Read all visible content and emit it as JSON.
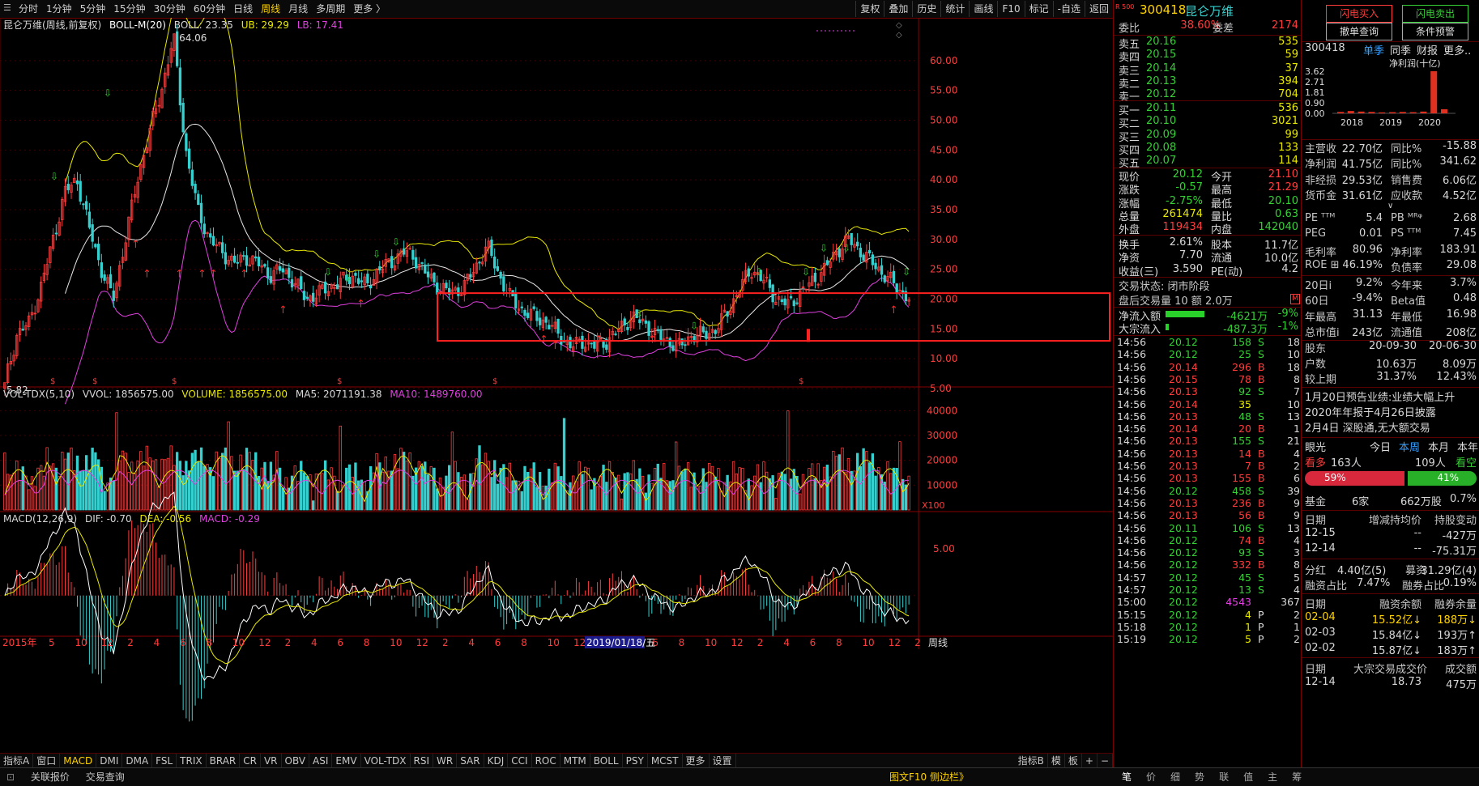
{
  "toolbar": {
    "left": [
      "分时",
      "1分钟",
      "5分钟",
      "15分钟",
      "30分钟",
      "60分钟",
      "日线",
      "周线",
      "月线",
      "多周期",
      "更多 〉"
    ],
    "active": "周线",
    "right": [
      "复权",
      "叠加",
      "历史",
      "统计",
      "画线",
      "F10",
      "标记",
      "-自选",
      "返回"
    ]
  },
  "main_legend": {
    "title": "昆仑万维(周线,前复权)",
    "boll": "BOLL-M(20)",
    "boll_val": "BOLL: 23.35",
    "ub": "UB: 29.29",
    "lb": "LB: 17.41"
  },
  "vol_legend": {
    "name": "VOL-TDX(5,10)",
    "vvol": "VVOL: 1856575.00",
    "volume": "VOLUME: 1856575.00",
    "ma5": "MA5: 2071191.38",
    "ma10": "MA10: 1489760.00"
  },
  "macd_legend": {
    "name": "MACD(12,26,9)",
    "dif": "DIF: -0.70",
    "dea": "DEA: -0.56",
    "macd": "MACD: -0.29"
  },
  "price_axis": [
    "60.00",
    "55.00",
    "50.00",
    "45.00",
    "40.00",
    "35.00",
    "30.00",
    "25.00",
    "20.00",
    "15.00",
    "10.00",
    "5.00"
  ],
  "vol_axis": [
    "40000",
    "30000",
    "20000",
    "10000"
  ],
  "vol_unit": "X100",
  "macd_axis": [
    "5.00"
  ],
  "high_label": "64.06",
  "low_label": "5.82",
  "time_axis": {
    "year": "2015年",
    "labels": [
      "5",
      "10",
      "12",
      "2",
      "4",
      "6",
      "8",
      "10",
      "12",
      "2",
      "4",
      "6",
      "8",
      "10",
      "12",
      "2",
      "4",
      "6",
      "8",
      "10",
      "12",
      "2",
      "4",
      "6",
      "8",
      "10",
      "12",
      "2",
      "4",
      "6",
      "8",
      "10",
      "12",
      "2"
    ],
    "cursor": "2019/01/18/五",
    "unit": "周线"
  },
  "indicator_tabs": [
    "指标A",
    "窗口",
    "MACD",
    "DMI",
    "DMA",
    "FSL",
    "TRIX",
    "BRAR",
    "CR",
    "VR",
    "OBV",
    "ASI",
    "EMV",
    "VOL-TDX",
    "RSI",
    "WR",
    "SAR",
    "KDJ",
    "CCI",
    "ROC",
    "MTM",
    "BOLL",
    "PSY",
    "MCST",
    "更多",
    "设置"
  ],
  "indicator_active": "MACD",
  "indicator_right": [
    "指标B",
    "模",
    "板",
    "+",
    "−"
  ],
  "status_left": [
    "关联报价",
    "交易查询"
  ],
  "status_right": "图文F10 侧边栏》",
  "status_tabs": [
    "笔",
    "价",
    "细",
    "势",
    "联",
    "值",
    "主",
    "筹"
  ],
  "stock": {
    "code": "300418",
    "name": "昆仑万维",
    "badge": "R 500"
  },
  "weibi": {
    "label1": "委比",
    "v1": "38.60%",
    "label2": "委差",
    "v2": "2174"
  },
  "asks": [
    {
      "l": "卖五",
      "p": "20.16",
      "v": "535"
    },
    {
      "l": "卖四",
      "p": "20.15",
      "v": "59"
    },
    {
      "l": "卖三",
      "p": "20.14",
      "v": "37"
    },
    {
      "l": "卖二",
      "p": "20.13",
      "v": "394"
    },
    {
      "l": "卖一",
      "p": "20.12",
      "v": "704"
    }
  ],
  "bids": [
    {
      "l": "买一",
      "p": "20.11",
      "v": "536"
    },
    {
      "l": "买二",
      "p": "20.10",
      "v": "3021"
    },
    {
      "l": "买三",
      "p": "20.09",
      "v": "99"
    },
    {
      "l": "买四",
      "p": "20.08",
      "v": "133"
    },
    {
      "l": "买五",
      "p": "20.07",
      "v": "114"
    }
  ],
  "stats": [
    {
      "l": "现价",
      "v": "20.12",
      "c": "dn",
      "l2": "今开",
      "v2": "21.10",
      "c2": "up"
    },
    {
      "l": "涨跌",
      "v": "-0.57",
      "c": "dn",
      "l2": "最高",
      "v2": "21.29",
      "c2": "up"
    },
    {
      "l": "涨幅",
      "v": "-2.75%",
      "c": "dn",
      "l2": "最低",
      "v2": "20.10",
      "c2": "dn"
    },
    {
      "l": "总量",
      "v": "261474",
      "c": "yl",
      "l2": "量比",
      "v2": "0.63",
      "c2": "dn"
    },
    {
      "l": "外盘",
      "v": "119434",
      "c": "up",
      "l2": "内盘",
      "v2": "142040",
      "c2": "dn"
    }
  ],
  "stats2": [
    {
      "l": "换手",
      "v": "2.61%",
      "l2": "股本",
      "v2": "11.7亿"
    },
    {
      "l": "净资",
      "v": "7.70",
      "l2": "流通",
      "v2": "10.0亿"
    },
    {
      "l": "收益(三)",
      "v": "3.590",
      "l2": "PE(动)",
      "v2": "4.2"
    }
  ],
  "trade_state": "交易状态: 闭市阶段",
  "after_hours": "盘后交易量 10 额 2.0万",
  "flow": [
    {
      "l": "净流入额",
      "v": "-4621万",
      "p": "-9%"
    },
    {
      "l": "大宗流入",
      "v": "-487.3万",
      "p": "-1%"
    }
  ],
  "ticks": [
    [
      "14:56",
      "20.12",
      "158",
      "S",
      "18"
    ],
    [
      "14:56",
      "20.12",
      "25",
      "S",
      "10"
    ],
    [
      "14:56",
      "20.14",
      "296",
      "B",
      "18"
    ],
    [
      "14:56",
      "20.15",
      "78",
      "B",
      "8"
    ],
    [
      "14:56",
      "20.13",
      "92",
      "S",
      "7"
    ],
    [
      "14:56",
      "20.14",
      "35",
      "",
      "10"
    ],
    [
      "14:56",
      "20.13",
      "48",
      "S",
      "13"
    ],
    [
      "14:56",
      "20.14",
      "20",
      "B",
      "1"
    ],
    [
      "14:56",
      "20.13",
      "155",
      "S",
      "21"
    ],
    [
      "14:56",
      "20.13",
      "14",
      "B",
      "4"
    ],
    [
      "14:56",
      "20.13",
      "7",
      "B",
      "2"
    ],
    [
      "14:56",
      "20.13",
      "155",
      "B",
      "6"
    ],
    [
      "14:56",
      "20.12",
      "458",
      "S",
      "39"
    ],
    [
      "14:56",
      "20.13",
      "236",
      "B",
      "9"
    ],
    [
      "14:56",
      "20.13",
      "56",
      "B",
      "9"
    ],
    [
      "14:56",
      "20.11",
      "106",
      "S",
      "13"
    ],
    [
      "14:56",
      "20.12",
      "74",
      "B",
      "4"
    ],
    [
      "14:56",
      "20.12",
      "93",
      "S",
      "3"
    ],
    [
      "14:56",
      "20.12",
      "332",
      "B",
      "8"
    ],
    [
      "14:57",
      "20.12",
      "45",
      "S",
      "5"
    ],
    [
      "14:57",
      "20.12",
      "13",
      "S",
      "4"
    ],
    [
      "15:00",
      "20.12",
      "4543",
      "",
      "367"
    ],
    [
      "15:15",
      "20.12",
      "4",
      "P",
      "2"
    ],
    [
      "15:18",
      "20.12",
      "1",
      "P",
      "1"
    ],
    [
      "15:19",
      "20.12",
      "5",
      "P",
      "2"
    ]
  ],
  "buttons": {
    "flash_buy": "闪电买入",
    "flash_sell": "闪电卖出",
    "cancel": "撤单查询",
    "cond": "条件预警"
  },
  "f10": {
    "code": "300418",
    "tabs": [
      "单季",
      "同季",
      "财报",
      "更多.."
    ],
    "bar_axis": [
      "3.62",
      "2.71",
      "1.81",
      "0.90",
      "0.00"
    ],
    "bar_title": "净利润(十亿)",
    "bar_years": [
      "2018",
      "2019",
      "2020"
    ],
    "bar_values": [
      0.12,
      0.2,
      0.15,
      0.12,
      0.08,
      0.1,
      0.12,
      0.1,
      0.15,
      3.62,
      0.35
    ],
    "fin": [
      [
        "主营收",
        "22.70亿",
        "同比%",
        "-15.88"
      ],
      [
        "净利润",
        "41.75亿",
        "同比%",
        "341.62"
      ],
      [
        "非经损",
        "29.53亿",
        "销售费",
        "6.06亿"
      ],
      [
        "货币金",
        "31.61亿",
        "应收款",
        "4.52亿"
      ]
    ],
    "val": [
      [
        "PE ᵀᵀᴹ",
        "5.4",
        "PB ᴹᴿᵠ",
        "2.68"
      ],
      [
        "PEG",
        "0.01",
        "PS ᵀᵀᴹ",
        "7.45"
      ],
      [
        "毛利率",
        "80.96",
        "净利率",
        "183.91"
      ],
      [
        "ROE ⊞",
        "46.19%",
        "负债率",
        "29.08"
      ]
    ],
    "perf": [
      [
        "20日i",
        "9.2%",
        "今年来",
        "3.7%"
      ],
      [
        "60日",
        "-9.4%",
        "Beta值",
        "0.48"
      ],
      [
        "年最高",
        "31.13",
        "年最低",
        "16.98"
      ],
      [
        "总市值i",
        "243亿",
        "流通值",
        "208亿"
      ]
    ],
    "holders": [
      [
        "股东",
        "20-09-30",
        "20-06-30"
      ],
      [
        "户数",
        "10.63万",
        "8.09万"
      ],
      [
        "较上期",
        "31.37%",
        "12.43%"
      ]
    ],
    "news": [
      "1月20日预告业绩:业绩大幅上升",
      "2020年年报于4月26日披露",
      "2月4日 深股通,无大额交易"
    ],
    "eye": {
      "label": "眼光",
      "tabs": [
        "今日",
        "本周",
        "本月",
        "本年"
      ],
      "bull_label": "看多",
      "bull": "163人",
      "bear": "109人",
      "bear_label": "看空",
      "bull_pct": "59%",
      "bear_pct": "41%"
    },
    "fund": [
      "基金",
      "6家",
      "662万股",
      "0.7%"
    ],
    "hold_head": [
      "日期",
      "增减持均价",
      "持股变动"
    ],
    "hold": [
      [
        "12-15",
        "--",
        "-427万"
      ],
      [
        "12-14",
        "--",
        "-75.31万"
      ]
    ],
    "div": [
      "分红",
      "4.40亿(5)",
      "募资",
      "31.29亿(4)"
    ],
    "margin_ratio": [
      "融资占比",
      "7.47%",
      "融券占比",
      "0.19%"
    ],
    "margin_head": [
      "日期",
      "融资余额",
      "融券余量"
    ],
    "margin": [
      [
        "02-04",
        "15.52亿↓",
        "188万↓"
      ],
      [
        "02-03",
        "15.84亿↓",
        "193万↑"
      ],
      [
        "02-02",
        "15.87亿↓",
        "183万↑"
      ]
    ],
    "block_head": [
      "日期",
      "大宗交易成交价",
      "成交额"
    ],
    "block": [
      [
        "12-14",
        "18.73",
        "475万"
      ]
    ]
  },
  "colors": {
    "up": "#ff3c3c",
    "down": "#35d0d0",
    "boll_mid": "#e8e8e8",
    "boll_up": "#e8e800",
    "boll_low": "#e040e0"
  },
  "chart_data": {
    "type": "candlestick",
    "weekly_close_path": [
      5.82,
      14,
      16,
      22,
      30,
      38,
      40,
      32,
      25,
      20,
      30,
      40,
      48,
      55,
      64.06,
      45,
      35,
      30,
      28,
      26,
      27,
      26,
      24,
      25,
      23,
      20,
      21,
      22,
      23,
      24,
      22,
      25,
      26,
      28,
      27,
      24,
      22,
      21,
      22,
      25,
      29,
      24,
      20,
      18,
      17,
      16,
      14,
      12,
      13,
      12,
      13,
      15,
      17,
      16,
      14,
      13,
      12,
      14,
      14,
      15,
      18,
      22,
      25,
      23,
      20,
      19,
      21,
      23,
      25,
      28,
      30,
      28,
      26,
      24,
      22,
      20.12
    ],
    "ylim": [
      5,
      65
    ],
    "volume_ylim": [
      0,
      45000
    ],
    "highlight_box": {
      "price_top": 21,
      "price_bottom": 13
    }
  }
}
